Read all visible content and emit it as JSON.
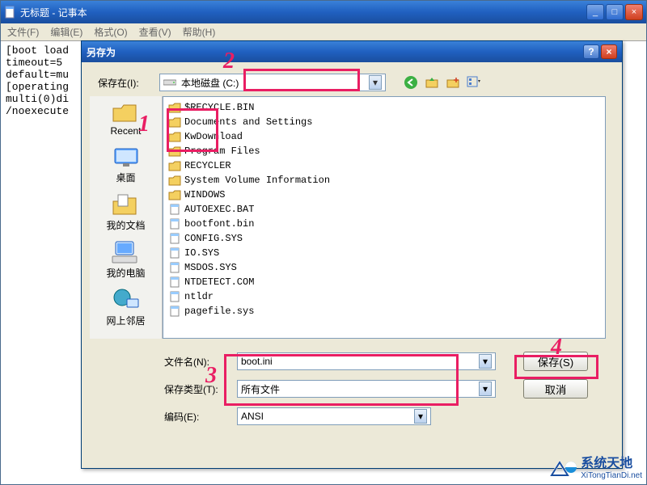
{
  "notepad": {
    "title": "无标题 - 记事本",
    "menus": [
      "文件(F)",
      "编辑(E)",
      "格式(O)",
      "查看(V)",
      "帮助(H)"
    ],
    "content_lines": [
      "[boot load",
      "timeout=5",
      "default=mu",
      "[operating",
      "multi(0)di",
      "/noexecute"
    ]
  },
  "saveas": {
    "title": "另存为",
    "save_in_label": "保存在(I):",
    "save_in_value": "本地磁盘 (C:)",
    "places": [
      {
        "label": "Recent"
      },
      {
        "label": "桌面"
      },
      {
        "label": "我的文档"
      },
      {
        "label": "我的电脑"
      },
      {
        "label": "网上邻居"
      }
    ],
    "files": [
      {
        "name": "$RECYCLE.BIN",
        "type": "folder"
      },
      {
        "name": "Documents and Settings",
        "type": "folder"
      },
      {
        "name": "KwDownload",
        "type": "folder"
      },
      {
        "name": "Program Files",
        "type": "folder"
      },
      {
        "name": "RECYCLER",
        "type": "folder"
      },
      {
        "name": "System Volume Information",
        "type": "folder"
      },
      {
        "name": "WINDOWS",
        "type": "folder"
      },
      {
        "name": "AUTOEXEC.BAT",
        "type": "file"
      },
      {
        "name": "bootfont.bin",
        "type": "file"
      },
      {
        "name": "CONFIG.SYS",
        "type": "file"
      },
      {
        "name": "IO.SYS",
        "type": "file"
      },
      {
        "name": "MSDOS.SYS",
        "type": "file"
      },
      {
        "name": "NTDETECT.COM",
        "type": "file"
      },
      {
        "name": "ntldr",
        "type": "file"
      },
      {
        "name": "pagefile.sys",
        "type": "file"
      }
    ],
    "filename_label": "文件名(N):",
    "filename_value": "boot.ini",
    "filetype_label": "保存类型(T):",
    "filetype_value": "所有文件",
    "encoding_label": "编码(E):",
    "encoding_value": "ANSI",
    "save_btn": "保存(S)",
    "cancel_btn": "取消"
  },
  "annotations": {
    "n1": "1",
    "n2": "2",
    "n3": "3",
    "n4": "4"
  },
  "watermark": {
    "brand": "系统天地",
    "url": "XiTongTianDi.net"
  }
}
